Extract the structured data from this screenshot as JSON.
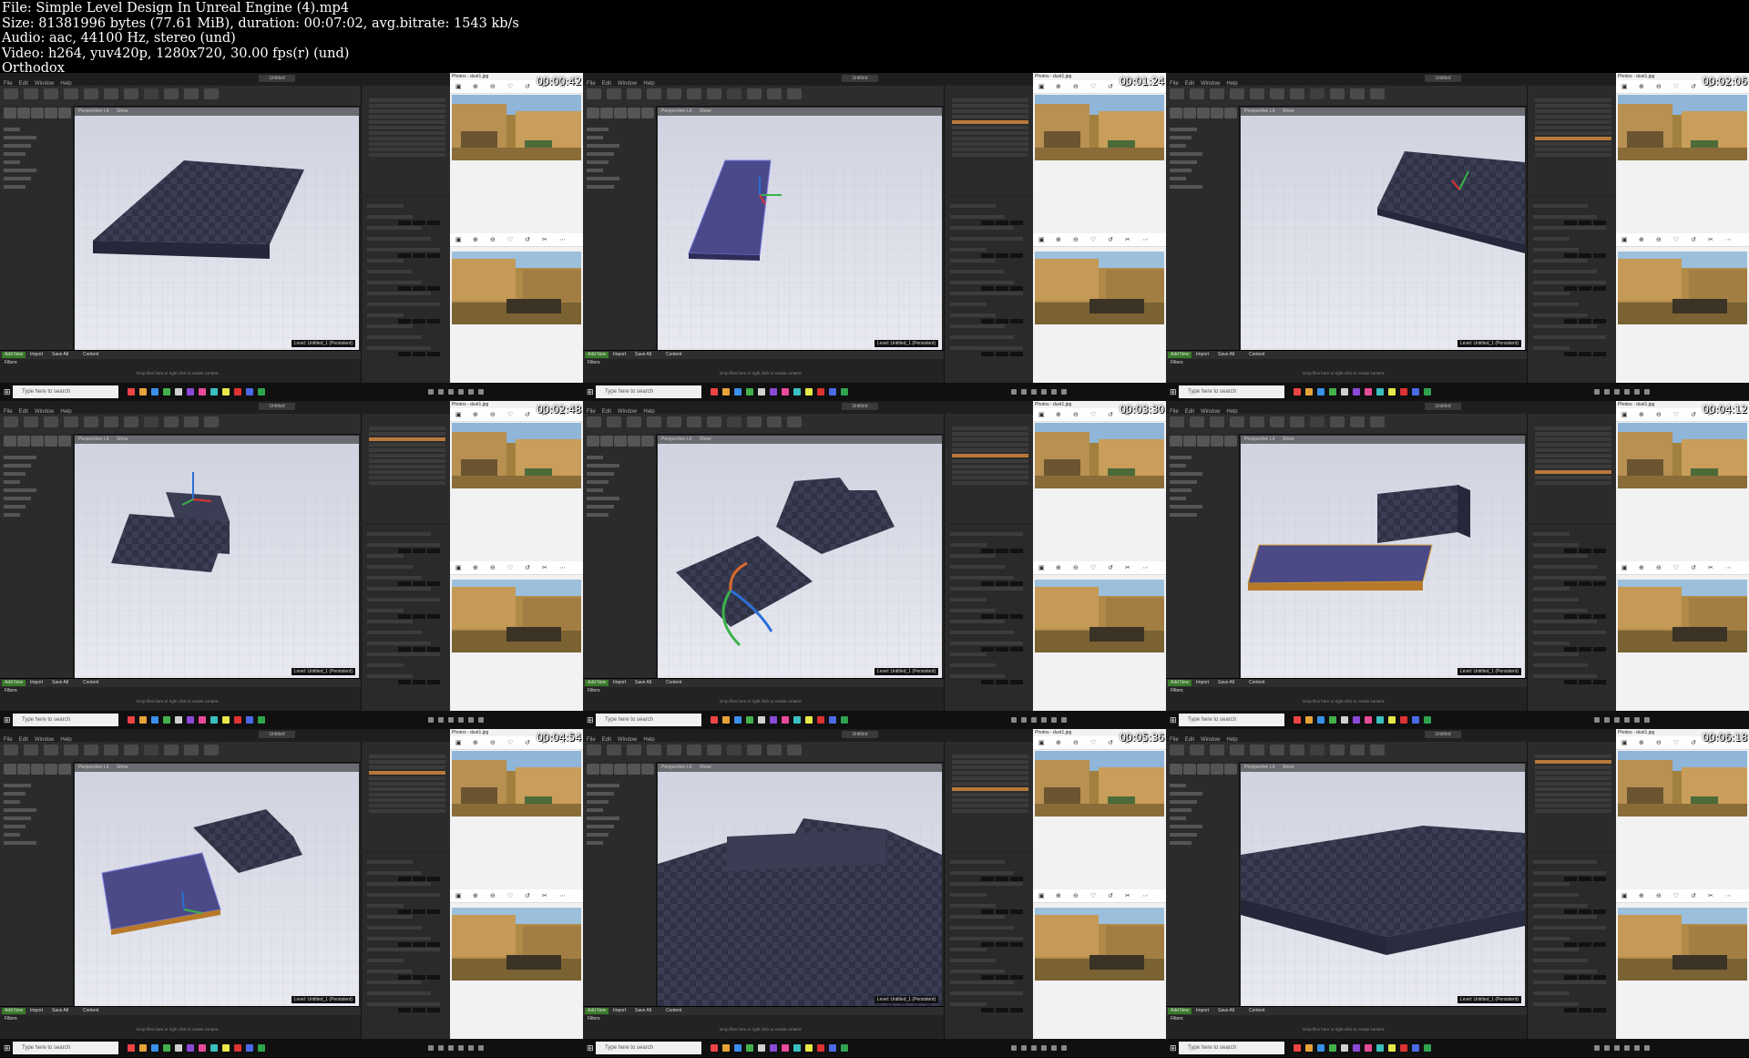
{
  "header": {
    "file": "File: Simple Level Design In Unreal Engine (4).mp4",
    "size": "Size: 81381996 bytes (77.61 MiB), duration: 00:07:02, avg.bitrate: 1543 kb/s",
    "audio": "Audio: aac, 44100 Hz, stereo (und)",
    "video": "Video: h264, yuv420p, 1280x720, 30.00 fps(r) (und)",
    "author": "Orthodox"
  },
  "editor": {
    "menu": [
      "File",
      "Edit",
      "Window",
      "Help"
    ],
    "tab_name": "Untitled",
    "viewport_labels": [
      "Perspective",
      "Lit",
      "Show"
    ],
    "level_label": "Level: Untitled_1 (Persistent)",
    "content_browser": {
      "add_new": "Add New",
      "import": "Import",
      "save_all": "Save All",
      "content": "Content",
      "filters": "Filters",
      "empty_hint": "Drop files here or right click to create content."
    }
  },
  "photos_title": "Photos - dust1.jpg",
  "taskbar": {
    "search_placeholder": "Type here to search"
  },
  "timestamps": [
    "00:00:42",
    "00:01:24",
    "00:02:06",
    "00:02:48",
    "00:03:30",
    "00:04:12",
    "00:04:54",
    "00:05:36",
    "00:06:18"
  ],
  "colors": {
    "ground": "#2f3245",
    "ground_light": "#4a4e66",
    "selected": "#4b4a86",
    "selection_edge": "#d9a23a",
    "sky": "#d7d9e6"
  },
  "icons": {
    "windows": "windows-icon",
    "search": "search-icon"
  }
}
